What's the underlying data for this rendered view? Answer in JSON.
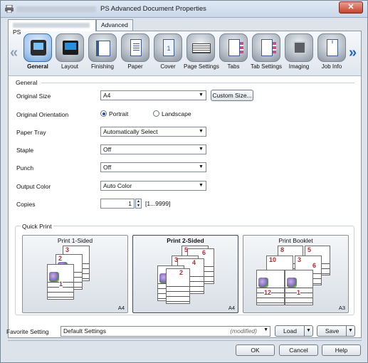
{
  "window": {
    "title": "PS Advanced Document Properties",
    "close_label": "✕"
  },
  "tabs": [
    {
      "label": "PS"
    },
    {
      "label": "Advanced"
    }
  ],
  "toolbar": {
    "items": [
      {
        "label": "General",
        "icon": "general-icon"
      },
      {
        "label": "Layout",
        "icon": "layout-icon"
      },
      {
        "label": "Finishing",
        "icon": "finishing-icon"
      },
      {
        "label": "Paper",
        "icon": "paper-icon"
      },
      {
        "label": "Cover",
        "icon": "cover-icon"
      },
      {
        "label": "Page Settings",
        "icon": "page-settings-icon"
      },
      {
        "label": "Tabs",
        "icon": "tabs-icon"
      },
      {
        "label": "Tab Settings",
        "icon": "tab-settings-icon"
      },
      {
        "label": "Imaging",
        "icon": "imaging-icon"
      },
      {
        "label": "Job Info",
        "icon": "job-info-icon"
      }
    ],
    "active_index": 0,
    "cover_glyph": "1",
    "jobinfo_glyph": "i"
  },
  "general": {
    "section_title": "General",
    "original_size": {
      "label": "Original Size",
      "value": "A4",
      "custom_button": "Custom Size..."
    },
    "orientation": {
      "label": "Original Orientation",
      "portrait": "Portrait",
      "landscape": "Landscape",
      "selected": "Portrait"
    },
    "paper_tray": {
      "label": "Paper Tray",
      "value": "Automatically Select"
    },
    "staple": {
      "label": "Staple",
      "value": "Off"
    },
    "punch": {
      "label": "Punch",
      "value": "Off"
    },
    "output_color": {
      "label": "Output Color",
      "value": "Auto Color"
    },
    "copies": {
      "label": "Copies",
      "value": "1",
      "range": "[1...9999]"
    }
  },
  "quick_print": {
    "title": "Quick Print",
    "options": [
      {
        "label": "Print 1-Sided",
        "paper_size": "A4",
        "selected": false,
        "sheet_numbers": [
          "3",
          "2",
          "1"
        ]
      },
      {
        "label": "Print 2-Sided",
        "paper_size": "A4",
        "selected": true,
        "sheet_numbers": [
          "5",
          "6",
          "3",
          "4",
          "1",
          "2"
        ]
      },
      {
        "label": "Print Booklet",
        "paper_size": "A3",
        "selected": false,
        "sheet_numbers": [
          "8",
          "5",
          "10",
          "3",
          "6",
          "12",
          "1"
        ]
      }
    ]
  },
  "footer": {
    "favorite_label": "Favorite Setting",
    "favorite_value": "Default Settings",
    "modified": "(modified)",
    "load": "Load",
    "save": "Save",
    "ok": "OK",
    "cancel": "Cancel",
    "help": "Help"
  }
}
